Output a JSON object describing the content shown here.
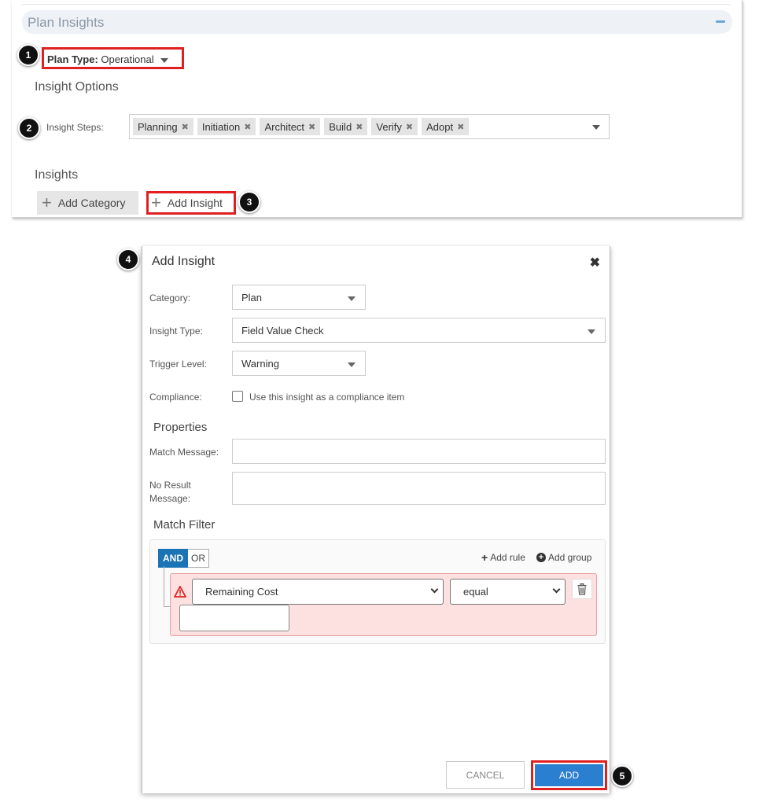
{
  "plan_insights": {
    "header_title": "Plan Insights",
    "plan_type_label": "Plan Type:",
    "plan_type_value": "Operational",
    "insight_options_heading": "Insight Options",
    "insight_steps_label": "Insight Steps:",
    "insight_steps": [
      "Planning",
      "Initiation",
      "Architect",
      "Build",
      "Verify",
      "Adopt"
    ],
    "insights_heading": "Insights",
    "add_category_label": "Add Category",
    "add_insight_label": "Add Insight"
  },
  "badges": [
    "1",
    "2",
    "3",
    "4",
    "5"
  ],
  "dialog": {
    "title": "Add Insight",
    "category_label": "Category:",
    "category_value": "Plan",
    "insight_type_label": "Insight Type:",
    "insight_type_value": "Field Value Check",
    "trigger_level_label": "Trigger Level:",
    "trigger_level_value": "Warning",
    "compliance_label": "Compliance:",
    "compliance_checkbox_label": "Use this insight as a compliance item",
    "compliance_checked": false,
    "properties_heading": "Properties",
    "match_message_label": "Match Message:",
    "match_message_value": "",
    "no_result_label_1": "No Result",
    "no_result_label_2": "Message:",
    "no_result_value": "",
    "match_filter_heading": "Match Filter",
    "and_label": "AND",
    "or_label": "OR",
    "add_rule_label": "Add rule",
    "add_group_label": "Add group",
    "rule_field_value": "Remaining Cost",
    "rule_operator_value": "equal",
    "rule_value": "",
    "cancel_label": "CANCEL",
    "add_label": "ADD"
  },
  "colors": {
    "highlight": "#e02020",
    "primary": "#2a7fd0",
    "and_active": "#1a73b5",
    "rule_error_bg": "#fde0e0"
  }
}
